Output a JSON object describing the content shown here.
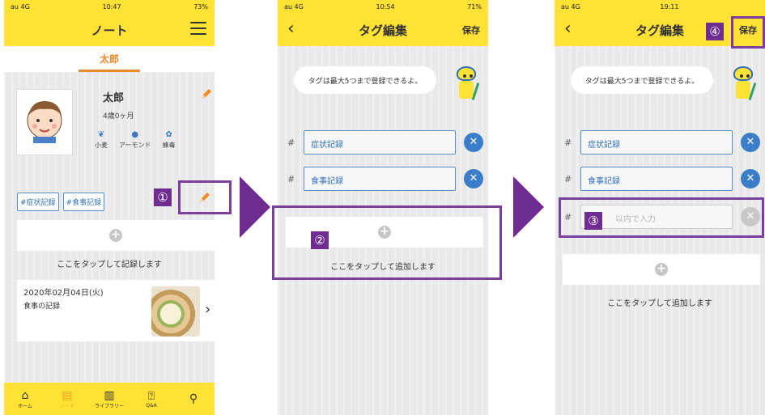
{
  "screen1": {
    "status": {
      "carrier": "au 4G",
      "time": "10:47",
      "battery": "73%"
    },
    "title": "ノート",
    "tab": "太郎",
    "profile": {
      "name": "太郎",
      "age": "4歳0ヶ月"
    },
    "allergies": [
      {
        "icon": "wheat-icon",
        "label": "小麦"
      },
      {
        "icon": "almond-icon",
        "label": "アーモンド"
      },
      {
        "icon": "bee-icon",
        "label": "蜂毒"
      }
    ],
    "tags": [
      "#症状記録",
      "#食事記録"
    ],
    "record_prompt": "ここをタップして記録します",
    "entry": {
      "date": "2020年02月04日(火)",
      "type": "食事の記録"
    },
    "bottom_nav": [
      {
        "icon": "home-icon",
        "label": "ホーム"
      },
      {
        "icon": "note-icon",
        "label": "ノート"
      },
      {
        "icon": "library-icon",
        "label": "ライブラリー"
      },
      {
        "icon": "qa-icon",
        "label": "Q&A"
      },
      {
        "icon": "pin-icon",
        "label": ""
      }
    ]
  },
  "screen2": {
    "status": {
      "carrier": "au 4G",
      "time": "10:54",
      "battery": "71%"
    },
    "title": "タグ編集",
    "save_label": "保存",
    "bubble": "タグは最大5つまで登録できるよ。",
    "tags": [
      "症状記録",
      "食事記録"
    ],
    "add_prompt": "ここをタップして追加します"
  },
  "screen3": {
    "status": {
      "carrier": "au 4G",
      "time": "19:11",
      "battery": ""
    },
    "title": "タグ編集",
    "save_label": "保存",
    "bubble": "タグは最大5つまで登録できるよ。",
    "tags": [
      "症状記録",
      "食事記録"
    ],
    "new_tag_placeholder": "以内で入力",
    "add_prompt": "ここをタップして追加します"
  },
  "annotations": {
    "step1": "①",
    "step2": "②",
    "step3": "③",
    "step4": "④"
  },
  "colors": {
    "header": "#ffe234",
    "accent": "#6f2c91",
    "tag_blue": "#3a7dc8",
    "tab_orange": "#e98a2a"
  }
}
